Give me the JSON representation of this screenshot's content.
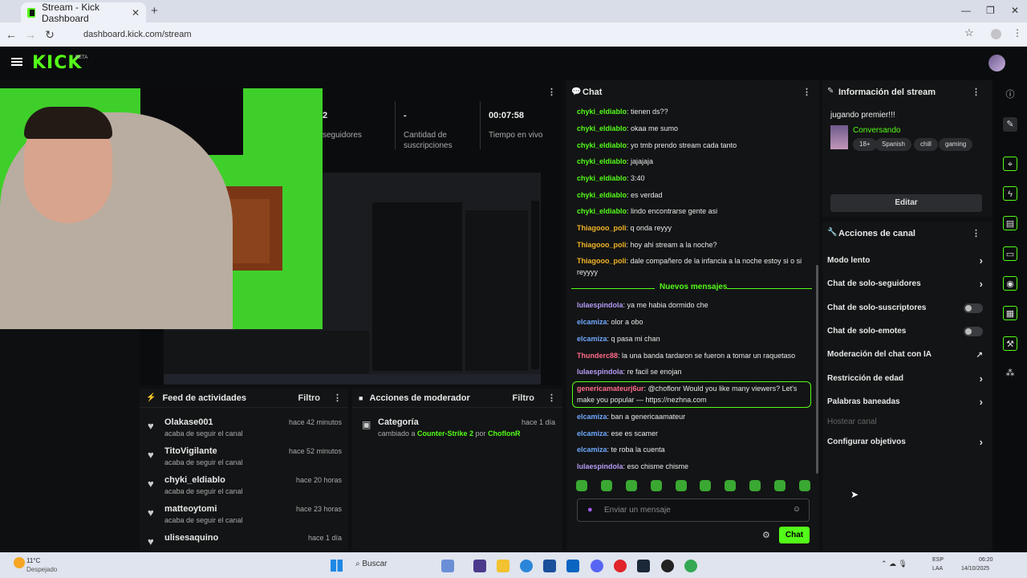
{
  "browser": {
    "tab_title": "Stream - Kick Dashboard",
    "url": "dashboard.kick.com/stream"
  },
  "header": {
    "logo": "KICK",
    "beta": "BETA"
  },
  "stats": [
    {
      "value": "2",
      "label": "seguidores"
    },
    {
      "value": "-",
      "label": "Cantidad de suscripciones"
    },
    {
      "value": "00:07:58",
      "label": "Tiempo en vivo"
    }
  ],
  "feed": {
    "title": "Feed de actividades",
    "filter": "Filtro",
    "items": [
      {
        "user": "Olakase001",
        "action": "acaba de seguir el canal",
        "time": "hace 42 minutos"
      },
      {
        "user": "TitoVigilante",
        "action": "acaba de seguir el canal",
        "time": "hace 52 minutos"
      },
      {
        "user": "chyki_eldiablo",
        "action": "acaba de seguir el canal",
        "time": "hace 20 horas"
      },
      {
        "user": "matteoytomi",
        "action": "acaba de seguir el canal",
        "time": "hace 23 horas"
      },
      {
        "user": "ulisesaquino",
        "action": "",
        "time": "hace 1 día"
      }
    ]
  },
  "modact": {
    "title": "Acciones de moderador",
    "filter": "Filtro",
    "item": {
      "title": "Categoría",
      "pre": "cambiado a ",
      "cat": "Counter-Strike 2",
      "by": " por ",
      "user": "ChoflonR",
      "time": "hace 1 día"
    }
  },
  "chat": {
    "title": "Chat",
    "new_messages": "Nuevos mensajes",
    "placeholder": "Enviar un mensaje",
    "send": "Chat",
    "messages": [
      {
        "user": "chyki_eldiablo",
        "text": ": tienen ds??",
        "color": "#53fc18"
      },
      {
        "user": "chyki_eldiablo",
        "text": ": okaa me sumo",
        "color": "#53fc18"
      },
      {
        "user": "chyki_eldiablo",
        "text": ": yo tmb prendo stream cada tanto",
        "color": "#53fc18"
      },
      {
        "user": "chyki_eldiablo",
        "text": ": jajajaja",
        "color": "#53fc18"
      },
      {
        "user": "chyki_eldiablo",
        "text": ": 3:40",
        "color": "#53fc18"
      },
      {
        "user": "chyki_eldiablo",
        "text": ": es verdad",
        "color": "#53fc18"
      },
      {
        "user": "chyki_eldiablo",
        "text": ": lindo encontrarse gente asi",
        "color": "#53fc18"
      },
      {
        "user": "Thiagooo_poli",
        "text": ": q onda reyyy",
        "color": "#f0b429"
      },
      {
        "user": "Thiagooo_poli",
        "text": ": hoy ahi stream a la noche?",
        "color": "#f0b429"
      },
      {
        "user": "Thiagooo_poli",
        "text": ": dale compañero de la infancia a la noche estoy si o si reyyyy",
        "color": "#f0b429"
      },
      {
        "user": "lulaespindola",
        "text": ": ya me habia dormido che",
        "color": "#b59cf5"
      },
      {
        "user": "elcamiza",
        "text": ": olor a obo",
        "color": "#6fa8ff"
      },
      {
        "user": "elcamiza",
        "text": ": q pasa mi chan",
        "color": "#6fa8ff"
      },
      {
        "user": "Thunderc88",
        "text": ": la una banda tardaron se fueron a tomar un raquetaso",
        "color": "#ff6b8a"
      },
      {
        "user": "lulaespindola",
        "text": ": re facil se enojan",
        "color": "#b59cf5"
      },
      {
        "user": "genericamateurj6ur",
        "text": ": @choflonr Would you like many viewers? Let's make you popular — https://nezhna.com",
        "color": "#ff6b8a"
      },
      {
        "user": "elcamiza",
        "text": ": ban a genericaamateur",
        "color": "#6fa8ff"
      },
      {
        "user": "elcamiza",
        "text": ": ese es scamer",
        "color": "#6fa8ff"
      },
      {
        "user": "elcamiza",
        "text": ": te roba la cuenta",
        "color": "#6fa8ff"
      },
      {
        "user": "lulaespindola",
        "text": ": eso chisme chisme",
        "color": "#b59cf5"
      }
    ]
  },
  "info": {
    "title": "Información del stream",
    "stream_title": "jugando premier!!!",
    "category": "Conversando",
    "tags": [
      "18+",
      "Spanish",
      "chill",
      "gaming"
    ],
    "edit": "Editar"
  },
  "actions": {
    "title": "Acciones de canal",
    "items": [
      {
        "label": "Modo lento",
        "kind": "chevron"
      },
      {
        "label": "Chat de solo-seguidores",
        "kind": "chevron"
      },
      {
        "label": "Chat de solo-suscriptores",
        "kind": "toggle"
      },
      {
        "label": "Chat de solo-emotes",
        "kind": "toggle"
      },
      {
        "label": "Moderación del chat con IA",
        "kind": "external"
      },
      {
        "label": "Restricción de edad",
        "kind": "chevron"
      },
      {
        "label": "Palabras baneadas",
        "kind": "chevron"
      },
      {
        "label": "Hostear canal",
        "kind": "disabled"
      },
      {
        "label": "Configurar objetivos",
        "kind": "chevron"
      }
    ]
  },
  "taskbar": {
    "temp": "11°C",
    "weather": "Despejado",
    "search": "Buscar",
    "lang1": "ESP",
    "lang2": "LAA",
    "time": "06:20",
    "date": "14/10/2025"
  }
}
